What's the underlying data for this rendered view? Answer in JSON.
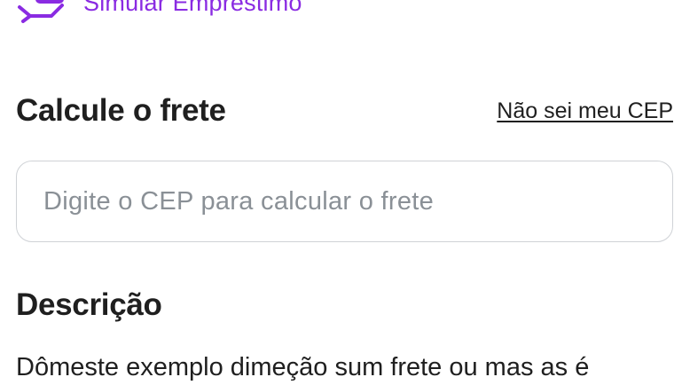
{
  "loan": {
    "label": "Simular Empréstimo",
    "icon": "hand-money-icon",
    "color": "#8a2be2"
  },
  "freight": {
    "title": "Calcule o frete",
    "cep_link": "Não sei meu CEP",
    "input_placeholder": "Digite o CEP para calcular o frete",
    "input_value": ""
  },
  "description": {
    "title": "Descrição",
    "text": "Dômeste exemplo dimeção sum frete ou mas as é"
  }
}
